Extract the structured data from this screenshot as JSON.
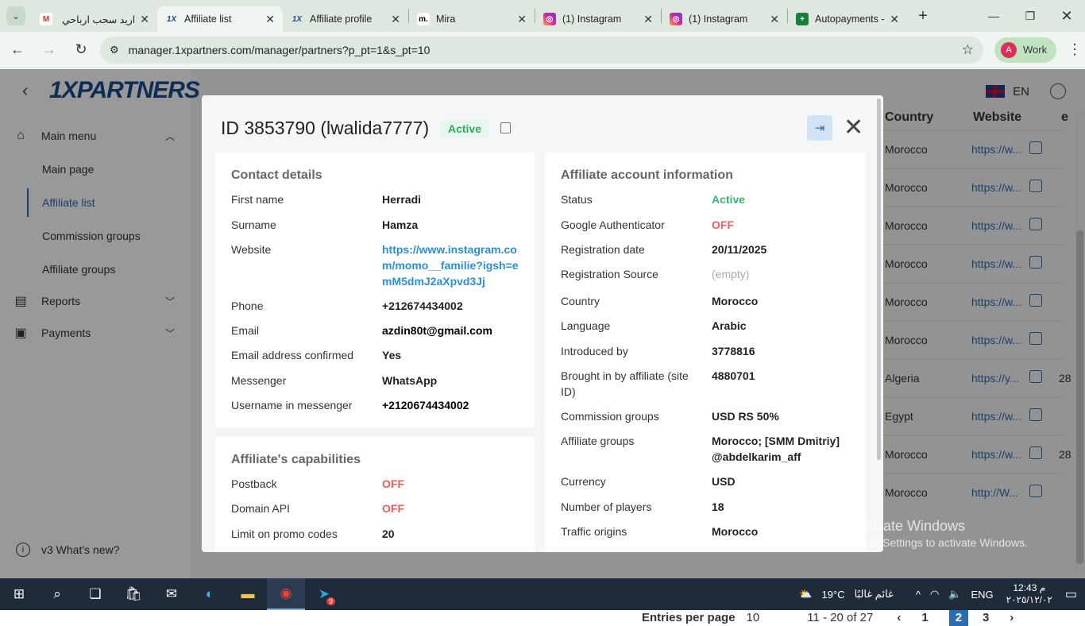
{
  "browser": {
    "tabs": [
      {
        "title": "اريد سحب ارباحي",
        "icon": "gmail-icon"
      },
      {
        "title": "Affiliate list",
        "icon": "1x-icon",
        "active": true
      },
      {
        "title": "Affiliate profile",
        "icon": "1x-icon"
      },
      {
        "title": "Mira",
        "icon": "mira-icon"
      },
      {
        "title": "(1) Instagram",
        "icon": "instagram-icon"
      },
      {
        "title": "(1) Instagram",
        "icon": "instagram-icon"
      },
      {
        "title": "Autopayments -",
        "icon": "sheets-icon"
      }
    ],
    "url": "manager.1xpartners.com/manager/partners?p_pt=1&s_pt=10",
    "profile_initial": "A",
    "profile_label": "Work"
  },
  "app": {
    "logo": "1XPARTNERS",
    "lang": "EN",
    "menu": {
      "main_menu": "Main menu",
      "main_page": "Main page",
      "affiliate_list": "Affiliate list",
      "commission_groups": "Commission groups",
      "affiliate_groups": "Affiliate groups",
      "reports": "Reports",
      "payments": "Payments",
      "whats_new": "v3 What's new?"
    },
    "table": {
      "col_country": "Country",
      "col_website": "Website",
      "col_extra": "e",
      "rows": [
        {
          "country": "Morocco",
          "website": "https://w...",
          "extra": ""
        },
        {
          "country": "Morocco",
          "website": "https://w...",
          "extra": ""
        },
        {
          "country": "Morocco",
          "website": "https://w...",
          "extra": ""
        },
        {
          "country": "Morocco",
          "website": "https://w...",
          "extra": ""
        },
        {
          "country": "Morocco",
          "website": "https://w...",
          "extra": ""
        },
        {
          "country": "Morocco",
          "website": "https://w...",
          "extra": ""
        },
        {
          "country": "Algeria",
          "website": "https://y...",
          "extra": "28"
        },
        {
          "country": "Egypt",
          "website": "https://w...",
          "extra": ""
        },
        {
          "country": "Morocco",
          "website": "https://w...",
          "extra": "28"
        },
        {
          "country": "Morocco",
          "website": "http://W...",
          "extra": ""
        }
      ],
      "entries_label": "Entries per page",
      "entries_value": "10",
      "range": "11 - 20 of 27",
      "pages": [
        "1",
        "2",
        "3"
      ]
    }
  },
  "modal": {
    "title": "ID 3853790 (lwalida7777)",
    "badge": "Active",
    "contact": {
      "heading": "Contact details",
      "rows": [
        {
          "label": "First name",
          "value": "Herradi"
        },
        {
          "label": "Surname",
          "value": "Hamza"
        },
        {
          "label": "Website",
          "value": "https://www.instagram.com/momo__familie?igsh=emM5dmJ2aXpvd3Jj"
        },
        {
          "label": "Phone",
          "value": "+212674434002"
        },
        {
          "label": "Email",
          "value": "azdin80t@gmail.com"
        },
        {
          "label": "Email address confirmed",
          "value": "Yes"
        },
        {
          "label": "Messenger",
          "value": "WhatsApp"
        },
        {
          "label": "Username in messenger",
          "value": "+2120674434002"
        }
      ]
    },
    "capabilities": {
      "heading": "Affiliate's capabilities",
      "rows": [
        {
          "label": "Postback",
          "value": "OFF"
        },
        {
          "label": "Domain API",
          "value": "OFF"
        },
        {
          "label": "Limit on promo codes",
          "value": "20"
        }
      ]
    },
    "account": {
      "heading": "Affiliate account information",
      "rows": [
        {
          "label": "Status",
          "value": "Active"
        },
        {
          "label": "Google Authenticator",
          "value": "OFF"
        },
        {
          "label": "Registration date",
          "value": "20/11/2025"
        },
        {
          "label": "Registration Source",
          "value": "(empty)"
        },
        {
          "label": "Country",
          "value": "Morocco"
        },
        {
          "label": "Language",
          "value": "Arabic"
        },
        {
          "label": "Introduced by",
          "value": "3778816"
        },
        {
          "label": "Brought in by affiliate (site ID)",
          "value": "4880701"
        },
        {
          "label": "Commission groups",
          "value": "USD RS 50%"
        },
        {
          "label": "Affiliate groups",
          "value": "Morocco; [SMM Dmitriy] @abdelkarim_aff"
        },
        {
          "label": "Currency",
          "value": "USD"
        },
        {
          "label": "Number of players",
          "value": "18"
        },
        {
          "label": "Traffic origins",
          "value": "Morocco"
        }
      ]
    }
  },
  "windows": {
    "activate_title": "Activate Windows",
    "activate_sub": "Go to Settings to activate Windows.",
    "weather_temp": "19°C",
    "weather_text": "غائم غالبًا",
    "lang": "ENG",
    "time": "12:43 م",
    "date": "٢٠٢٥/١٢/٠٢",
    "telegram_badge": "9"
  },
  "colors": {
    "accent": "#2b6cb0",
    "active_green": "#3bb86a",
    "off_red": "#ef5b5b",
    "link": "#2b8fd6"
  }
}
